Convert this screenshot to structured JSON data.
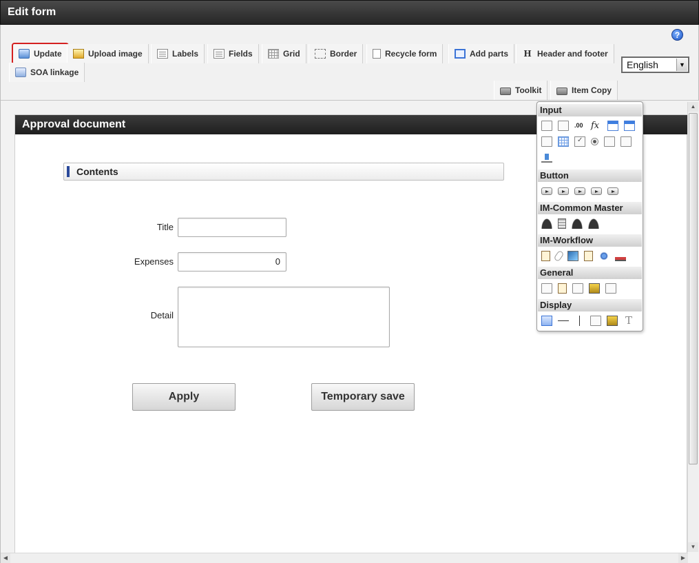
{
  "window": {
    "title": "Edit form"
  },
  "toolbar": {
    "row1": [
      {
        "label": "Update",
        "icon": "update-icon",
        "active": true
      },
      {
        "label": "Upload image",
        "icon": "upload-image-icon"
      },
      {
        "label": "Labels",
        "icon": "labels-icon"
      },
      {
        "label": "Fields",
        "icon": "fields-icon"
      },
      {
        "label": "Grid",
        "icon": "grid-icon"
      },
      {
        "label": "Border",
        "icon": "border-icon"
      },
      {
        "label": "Recycle form",
        "icon": "recycle-form-icon"
      },
      {
        "label": "Add parts",
        "icon": "add-parts-icon"
      },
      {
        "label": "Header and footer",
        "icon": "header-footer-icon",
        "glyph": "H"
      }
    ],
    "row2": [
      {
        "label": "SOA linkage",
        "icon": "soa-linkage-icon"
      }
    ],
    "right": [
      {
        "label": "Toolkit",
        "icon": "toolkit-icon"
      },
      {
        "label": "Item Copy",
        "icon": "item-copy-icon"
      }
    ],
    "language": "English",
    "help_glyph": "?"
  },
  "form": {
    "title": "Approval document",
    "section": "Contents",
    "fields": [
      {
        "label": "Title",
        "value": ""
      },
      {
        "label": "Expenses",
        "value": "0"
      },
      {
        "label": "Detail",
        "value": ""
      }
    ],
    "buttons": {
      "apply": "Apply",
      "temp_save": "Temporary save"
    }
  },
  "palette": {
    "sections": [
      {
        "title": "Input",
        "icons": [
          "text-box-icon",
          "text-box-label-icon",
          "number-icon",
          "formula-icon",
          "date-icon",
          "date-range-icon",
          "pulldown-icon",
          "table-icon",
          "checkbox-icon",
          "radio-icon",
          "list-box-icon",
          "multi-list-icon",
          "file-upload-icon"
        ]
      },
      {
        "title": "Button",
        "icons": [
          "submit-button-icon",
          "next-button-icon",
          "back-button-icon",
          "return-button-icon",
          "forward-button-icon"
        ]
      },
      {
        "title": "IM-Common Master",
        "icons": [
          "user-icon",
          "company-icon",
          "organization-icon",
          "role-icon"
        ]
      },
      {
        "title": "IM-Workflow",
        "icons": [
          "workflow-document-icon",
          "attachment-icon",
          "image-icon",
          "history-icon",
          "approver-icon",
          "stamp-icon"
        ]
      },
      {
        "title": "General",
        "icons": [
          "hidden-field-icon",
          "document-icon",
          "camera-icon",
          "key-icon",
          "panel-icon"
        ]
      },
      {
        "title": "Display",
        "icons": [
          "header-icon",
          "horizontal-line-icon",
          "vertical-line-icon",
          "rectangle-icon",
          "picture-icon",
          "text-icon"
        ]
      }
    ]
  },
  "scroll": {
    "up": "▲",
    "down": "▼",
    "left": "◀",
    "right": "▶"
  }
}
